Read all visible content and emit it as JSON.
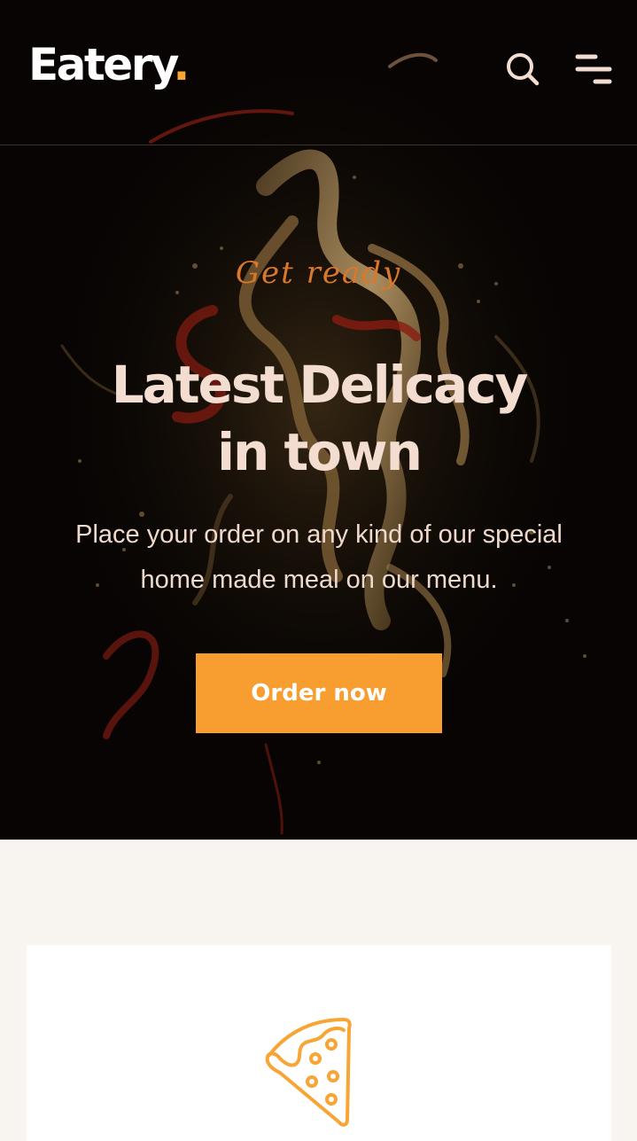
{
  "header": {
    "brand": "Eatery",
    "brand_dot": ".",
    "icons": [
      "search-icon",
      "menu-icon"
    ]
  },
  "hero": {
    "eyebrow": "Get ready",
    "headline_line1": "Latest Delicacy",
    "headline_line2": "in town",
    "description_line1": "Place your order on any kind of our special",
    "description_line2": "home made meal on our menu.",
    "cta_label": "Order now"
  },
  "features": {
    "card_icon": "pizza-slice-icon"
  },
  "colors": {
    "accent": "#f89d2f",
    "hero_background": "#070403",
    "headline": "#f3ddd0",
    "page_background": "#f8f5f0"
  }
}
